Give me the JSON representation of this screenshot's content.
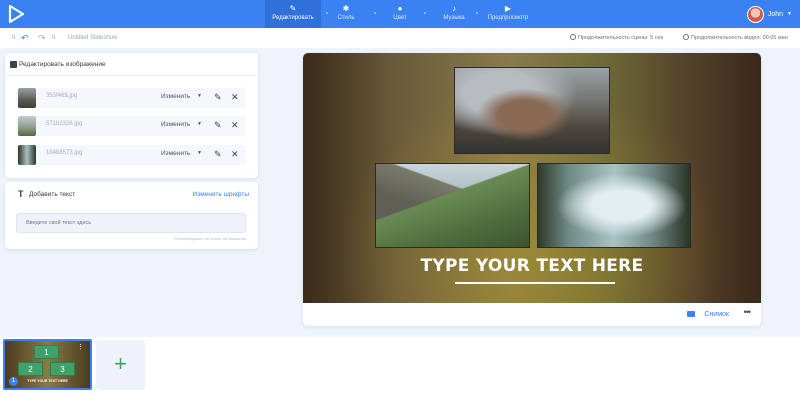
{
  "nav": {
    "tabs": [
      {
        "label": "Редактировать",
        "icon": "pencil-icon"
      },
      {
        "label": "Стиль",
        "icon": "style-icon"
      },
      {
        "label": "Цвет",
        "icon": "color-icon"
      },
      {
        "label": "Музыка",
        "icon": "music-icon"
      },
      {
        "label": "Предпросмотр",
        "icon": "play-icon"
      }
    ],
    "user": "John"
  },
  "toolbar": {
    "counter": "0",
    "project_name": "Untitled Slideshow",
    "scene_duration": "Продолжительность сцены: 5 сек",
    "video_duration": "Продолжительность видео: 00:05 мин"
  },
  "image_panel": {
    "title": "Редактировать изображение",
    "change_label": "Изменить",
    "images": [
      {
        "name": "353f46$.jpg"
      },
      {
        "name": "571b2326.jpg"
      },
      {
        "name": "184b8573.jpg"
      }
    ]
  },
  "text_panel": {
    "title": "Добавить текст",
    "fonts_link": "Изменить шрифты",
    "placeholder": "Введите свой текст здесь",
    "hint": "Рекомендовано не более 40 символов"
  },
  "canvas": {
    "headline": "TYPE YOUR TEXT HERE",
    "snapshot_label": "Снимок"
  },
  "timeline": {
    "slide_number": "1",
    "slots": [
      "1",
      "2",
      "3"
    ],
    "slide_text": "TYPE YOUR TEXT HERE",
    "add_label": "+"
  },
  "colors": {
    "accent": "#3a82f2",
    "slot_green": "#3ea26a"
  }
}
